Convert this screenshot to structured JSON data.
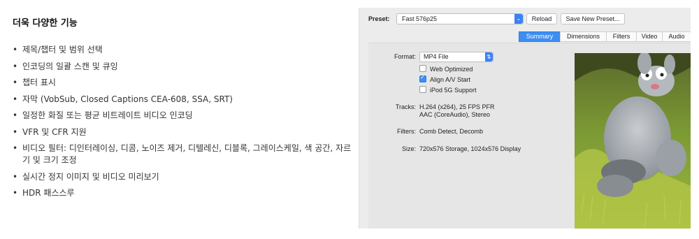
{
  "features": {
    "title": "더욱 다양한 기능",
    "bullet": "•",
    "items": [
      "제목/챕터 및 범위 선택",
      "인코딩의 일괄 스캔 및 큐잉",
      "챕터 표시",
      "자막 (VobSub, Closed Captions CEA-608, SSA, SRT)",
      "일정한 화질 또는 평균 비트레이트 비디오 인코딩",
      "VFR 및 CFR 지원",
      "비디오 필터: 디인터레이싱, 디콤, 노이즈 제거, 디텔레신, 디블록, 그레이스케일, 색 공간, 자르기 및 크기 조정",
      "실시간 정지 이미지 및 비디오 미리보기",
      "HDR 패스스루"
    ]
  },
  "app": {
    "preset_label": "Preset:",
    "preset_value": "Fast 576p25",
    "reload_label": "Reload",
    "save_preset_label": "Save New Preset...",
    "tabs": [
      "Summary",
      "Dimensions",
      "Filters",
      "Video",
      "Audio"
    ],
    "active_tab": "Summary",
    "format_label": "Format:",
    "format_value": "MP4 File",
    "options": [
      {
        "label": "Web Optimized",
        "checked": false
      },
      {
        "label": "Align A/V Start",
        "checked": true
      },
      {
        "label": "iPod 5G Support",
        "checked": false
      }
    ],
    "tracks_label": "Tracks:",
    "tracks_line1": "H.264 (x264), 25 FPS PFR",
    "tracks_line2": "AAC (CoreAudio), Stereo",
    "filters_label": "Filters:",
    "filters_value": "Comb Detect, Decomb",
    "size_label": "Size:",
    "size_value": "720x576 Storage, 1024x576 Display",
    "accent_color": "#3d8ef0"
  }
}
